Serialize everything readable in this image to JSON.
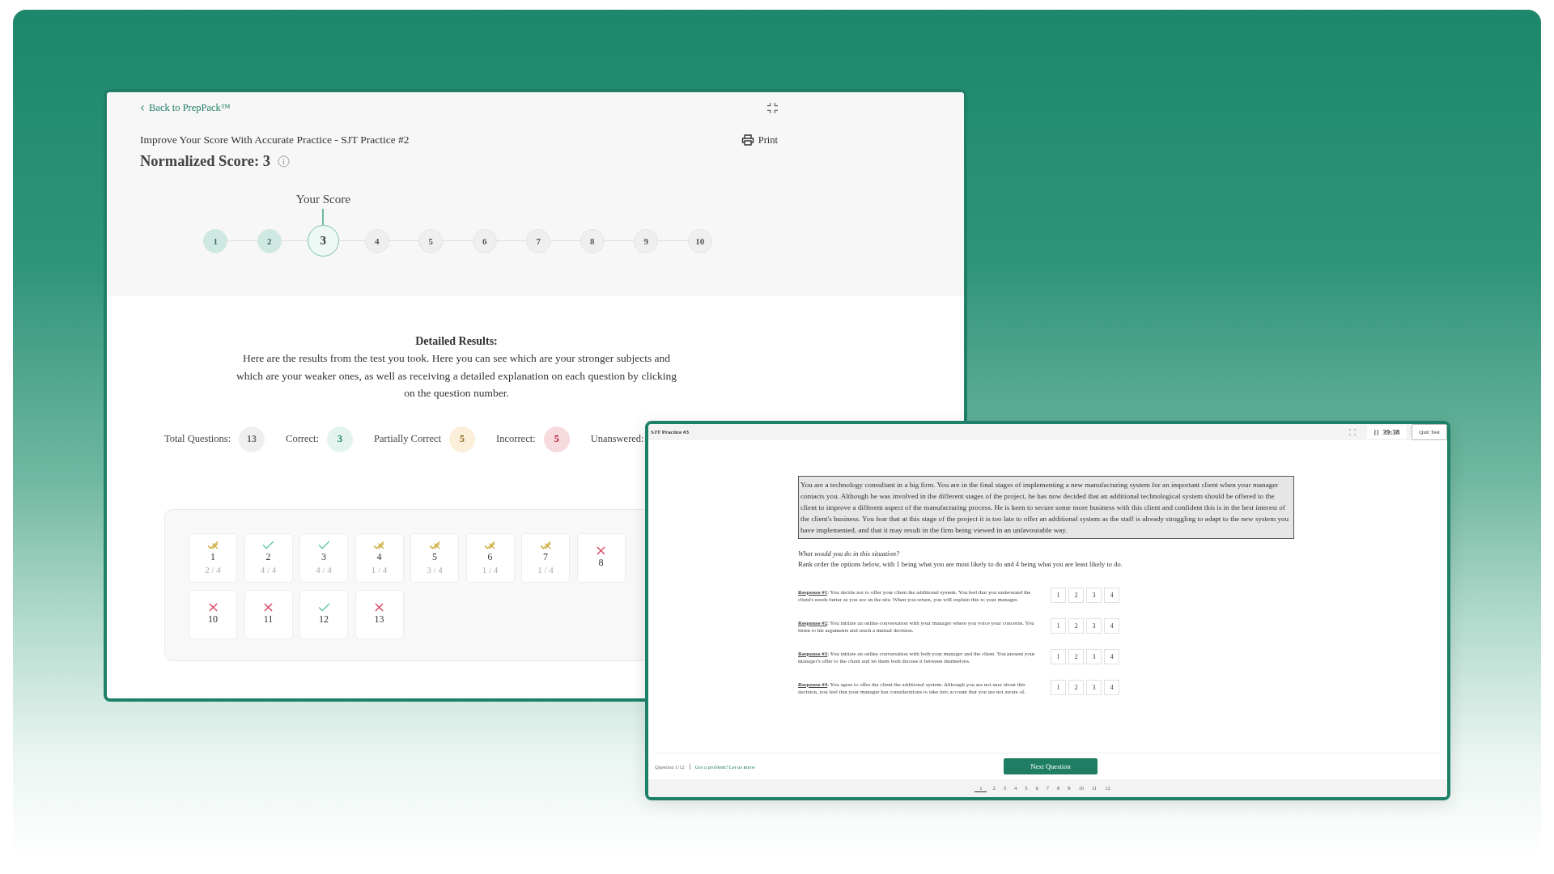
{
  "results_window": {
    "back_link": "Back to PrepPack™",
    "test_title": "Improve Your Score With Accurate Practice - SJT Practice #2",
    "print_label": "Print",
    "score_label": "Normalized Score: 3",
    "scale": {
      "caption": "Your Score",
      "steps": [
        {
          "label": "1",
          "reached": true,
          "selected": false
        },
        {
          "label": "2",
          "reached": true,
          "selected": false
        },
        {
          "label": "3",
          "reached": true,
          "selected": true
        },
        {
          "label": "4",
          "reached": false,
          "selected": false
        },
        {
          "label": "5",
          "reached": false,
          "selected": false
        },
        {
          "label": "6",
          "reached": false,
          "selected": false
        },
        {
          "label": "7",
          "reached": false,
          "selected": false
        },
        {
          "label": "8",
          "reached": false,
          "selected": false
        },
        {
          "label": "9",
          "reached": false,
          "selected": false
        },
        {
          "label": "10",
          "reached": false,
          "selected": false
        }
      ]
    },
    "detail_heading": "Detailed Results:",
    "detail_text": "Here are the results from the test you took. Here you can see which are your stronger subjects and which are your weaker ones, as well as receiving a detailed explanation on each question by clicking on the question number.",
    "stats": [
      {
        "label": "Total Questions:",
        "value": "13",
        "kind": "total"
      },
      {
        "label": "Correct:",
        "value": "3",
        "kind": "correct"
      },
      {
        "label": "Partially Correct",
        "value": "5",
        "kind": "partial"
      },
      {
        "label": "Incorrect:",
        "value": "5",
        "kind": "incorrect"
      },
      {
        "label": "Unanswered:"
      }
    ],
    "results": [
      {
        "number": "1",
        "kind": "partial",
        "score": "2 / 4"
      },
      {
        "number": "2",
        "kind": "correct",
        "score": "4 / 4"
      },
      {
        "number": "3",
        "kind": "correct",
        "score": "4 / 4"
      },
      {
        "number": "4",
        "kind": "partial",
        "score": "1 / 4"
      },
      {
        "number": "5",
        "kind": "partial",
        "score": "3 / 4"
      },
      {
        "number": "6",
        "kind": "partial",
        "score": "1 / 4"
      },
      {
        "number": "7",
        "kind": "partial",
        "score": "1 / 4"
      },
      {
        "number": "8",
        "kind": "incorrect"
      },
      {
        "number": "10",
        "kind": "incorrect"
      },
      {
        "number": "11",
        "kind": "incorrect"
      },
      {
        "number": "12",
        "kind": "correct"
      },
      {
        "number": "13",
        "kind": "incorrect"
      }
    ]
  },
  "quiz_window": {
    "title": "SJT Practice #3",
    "timer": "39:38",
    "quit_button": "Quit Test",
    "scenario": "You are a technology consultant in a big firm. You are in the final stages of implementing a new manufacturing system for an important client when your manager contacts you. Although he was involved in the different stages of the project, he has now decided that an additional technological system should be offered to the client to improve a different aspect of the manufacturing process. He is keen to secure some more business with this client and confident this is in the best interest of the client's business. You fear that at this stage of the project it is too late to offer an additional system as the staff is already struggling to adapt to the new system you have implemented, and that it may result in the firm being viewed in an unfavourable way.",
    "prompt": "What would you do in this situation?",
    "instruction": "Rank order the options below, with 1 being what you are most likely to do and 4 being what you are least likely to do.",
    "responses": [
      {
        "label": "Response #1",
        "text": ": You decide not to offer your client the additional system. You feel that you understand the client's needs better as you are on the site. When you return, you will explain this to your manager.",
        "ranks": [
          "1",
          "2",
          "3",
          "4"
        ]
      },
      {
        "label": "Response #2",
        "text": ": You initiate an online conversation with your manager where you voice your concerns. You listen to his arguments and reach a mutual decision.",
        "ranks": [
          "1",
          "2",
          "3",
          "4"
        ]
      },
      {
        "label": "Response #3",
        "text": ": You initiate an online conversation with both your manager and the client. You present your manager's offer to the client and let them both discuss it between themselves.",
        "ranks": [
          "1",
          "2",
          "3",
          "4"
        ]
      },
      {
        "label": "Response #4",
        "text": ": You agree to offer the client the additional system. Although you are not sure about this decision, you feel that your manager has considerations to take into account that you are not aware of.",
        "ranks": [
          "1",
          "2",
          "3",
          "4"
        ]
      }
    ],
    "question_counter": "Question 1/12",
    "report_link": "Got a problem? Let us know",
    "next_button": "Next Question",
    "pages": [
      {
        "label": "1",
        "selected": true
      },
      {
        "label": "2",
        "selected": false
      },
      {
        "label": "3",
        "selected": false
      },
      {
        "label": "4",
        "selected": false
      },
      {
        "label": "5",
        "selected": false
      },
      {
        "label": "6",
        "selected": false
      },
      {
        "label": "7",
        "selected": false
      },
      {
        "label": "8",
        "selected": false
      },
      {
        "label": "9",
        "selected": false
      },
      {
        "label": "10",
        "selected": false
      },
      {
        "label": "11",
        "selected": false
      },
      {
        "label": "12",
        "selected": false
      }
    ]
  }
}
